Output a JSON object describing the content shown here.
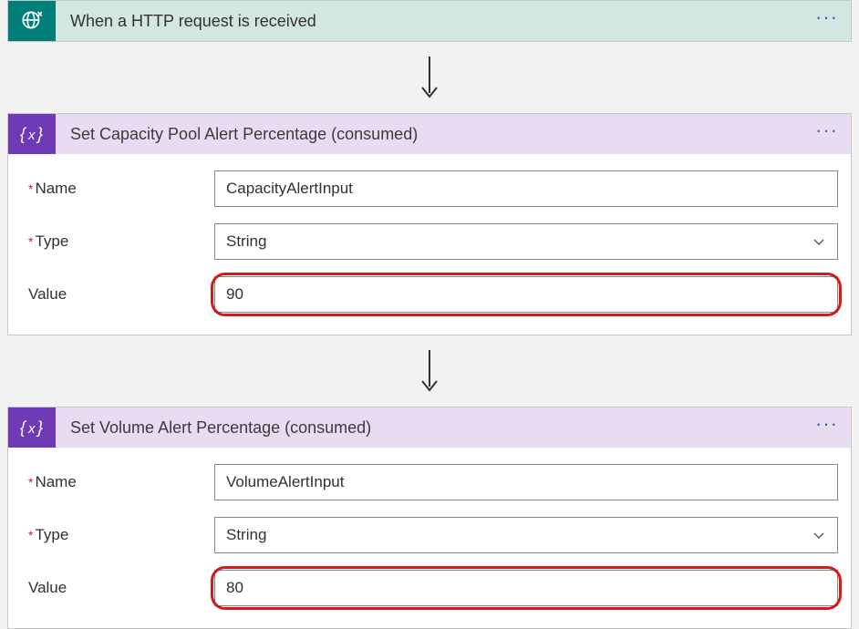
{
  "icons": {
    "more": "···"
  },
  "trigger": {
    "title": "When a HTTP request is received"
  },
  "action1": {
    "title": "Set Capacity Pool Alert Percentage (consumed)",
    "fields": {
      "name": {
        "label": "Name",
        "value": "CapacityAlertInput",
        "required": true
      },
      "type": {
        "label": "Type",
        "value": "String",
        "required": true
      },
      "value": {
        "label": "Value",
        "value": "90",
        "required": false,
        "highlight": true
      }
    }
  },
  "action2": {
    "title": "Set Volume Alert Percentage (consumed)",
    "fields": {
      "name": {
        "label": "Name",
        "value": "VolumeAlertInput",
        "required": true
      },
      "type": {
        "label": "Type",
        "value": "String",
        "required": true
      },
      "value": {
        "label": "Value",
        "value": "80",
        "required": false,
        "highlight": true
      }
    }
  }
}
